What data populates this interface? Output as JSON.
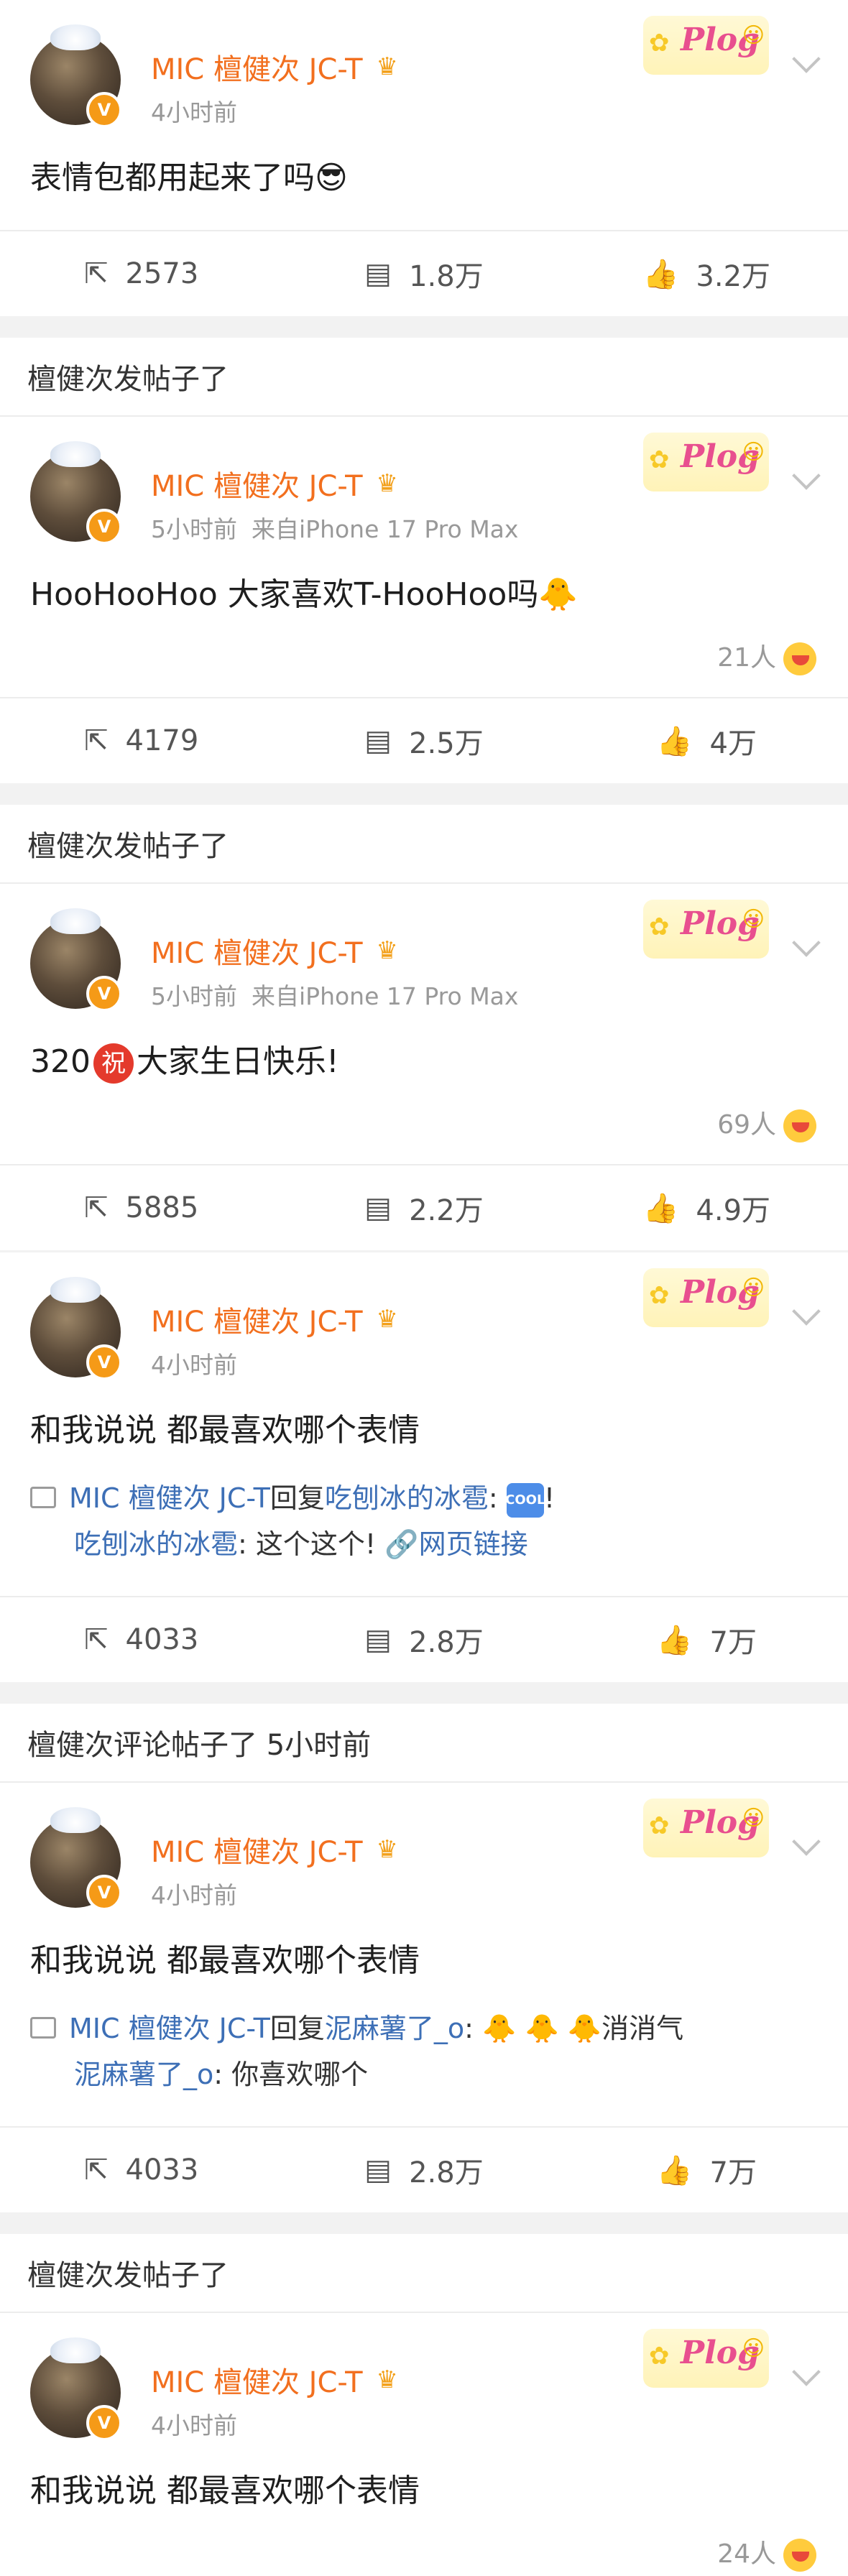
{
  "common": {
    "author": "MIC 檀健次 JC-T",
    "verified_glyph": "V",
    "crown_icon": "crown-badge-icon",
    "badge_text": "Plog",
    "icons": {
      "repost": "⇱",
      "comment": "☰",
      "like": "👍"
    }
  },
  "posts": [
    {
      "time": "4小时前",
      "device": "",
      "text": "表情包都用起来了吗",
      "emoji": "😎",
      "likers": "",
      "repost": "2573",
      "comment": "1.8万",
      "like": "3.2万"
    },
    {
      "section": "檀健次发帖子了",
      "time": "5小时前",
      "device": "来自iPhone 17 Pro Max",
      "text": "HooHooHoo 大家喜欢T-HooHoo吗",
      "emoji": "🐥",
      "likers": "21人",
      "repost": "4179",
      "comment": "2.5万",
      "like": "4万"
    },
    {
      "section": "檀健次发帖子了",
      "time": "5小时前",
      "device": "来自iPhone 17 Pro Max",
      "text_prefix": "320",
      "text_red": "祝",
      "text": "大家生日快乐!",
      "likers": "69人",
      "repost": "5885",
      "comment": "2.2万",
      "like": "4.9万"
    },
    {
      "time": "4小时前",
      "text": "和我说说 都最喜欢哪个表情",
      "quote_line1_author": "MIC 檀健次 JC-T",
      "quote_line1_mid": "回复",
      "quote_line1_target": "吃刨冰的冰雹",
      "quote_line1_tail": ":",
      "quote_line1_cool": "COOL",
      "quote_line1_end": "!",
      "quote_line2_user": "吃刨冰的冰雹",
      "quote_line2_text": ": 这个这个!",
      "quote_line2_link": "网页链接",
      "repost": "4033",
      "comment": "2.8万",
      "like": "7万"
    },
    {
      "section": "檀健次评论帖子了 5小时前",
      "time": "4小时前",
      "text": "和我说说 都最喜欢哪个表情",
      "quote_line1_author": "MIC 檀健次 JC-T",
      "quote_line1_mid": "回复",
      "quote_line1_target": "泥麻薯了_o",
      "quote_line1_tail": ":",
      "quote_line1_end": "消消气",
      "quote_line2_user": "泥麻薯了_o",
      "quote_line2_text": ": 你喜欢哪个",
      "repost": "4033",
      "comment": "2.8万",
      "like": "7万"
    },
    {
      "section": "檀健次发帖子了",
      "time": "4小时前",
      "text": "和我说说 都最喜欢哪个表情",
      "likers": "24人"
    }
  ]
}
